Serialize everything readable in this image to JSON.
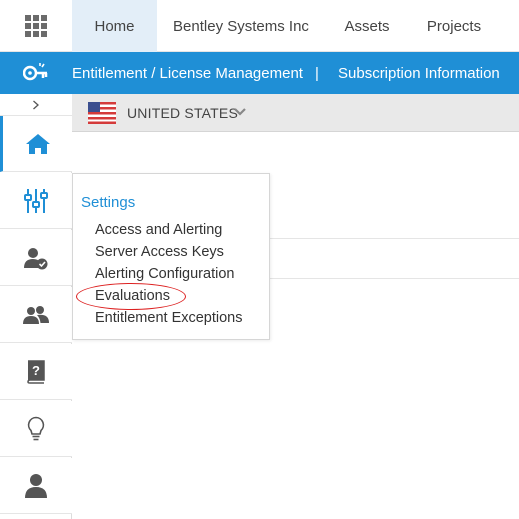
{
  "top_nav": {
    "apps_icon": "grid-icon",
    "tabs": [
      {
        "label": "Home",
        "active": true
      },
      {
        "label": "Bentley Systems Inc",
        "active": false
      },
      {
        "label": "Assets",
        "active": false
      },
      {
        "label": "Projects",
        "active": false
      }
    ]
  },
  "blue_bar": {
    "icon": "key-icon",
    "link1": "Entitlement / License Management",
    "separator": "|",
    "link2": "Subscription Information"
  },
  "sidebar": {
    "toggle_icon": "chevron-right-icon",
    "items": [
      {
        "icon": "home-icon",
        "active": true
      },
      {
        "icon": "sliders-icon",
        "active": false
      },
      {
        "icon": "user-check-icon",
        "active": false
      },
      {
        "icon": "users-icon",
        "active": false
      },
      {
        "icon": "help-book-icon",
        "active": false
      },
      {
        "icon": "lightbulb-icon",
        "active": false
      },
      {
        "icon": "user-icon",
        "active": false
      }
    ]
  },
  "country": {
    "label": "UNITED STATES",
    "flag": "us-flag-icon"
  },
  "settings_menu": {
    "title": "Settings",
    "items": [
      "Access and Alerting",
      "Server Access Keys",
      "Alerting Configuration",
      "Evaluations",
      "Entitlement Exceptions"
    ],
    "highlighted": "Evaluations"
  },
  "colors": {
    "accent": "#1f8fd6",
    "highlight_ring": "#dd2222",
    "active_tab_bg": "#e3eef8"
  }
}
